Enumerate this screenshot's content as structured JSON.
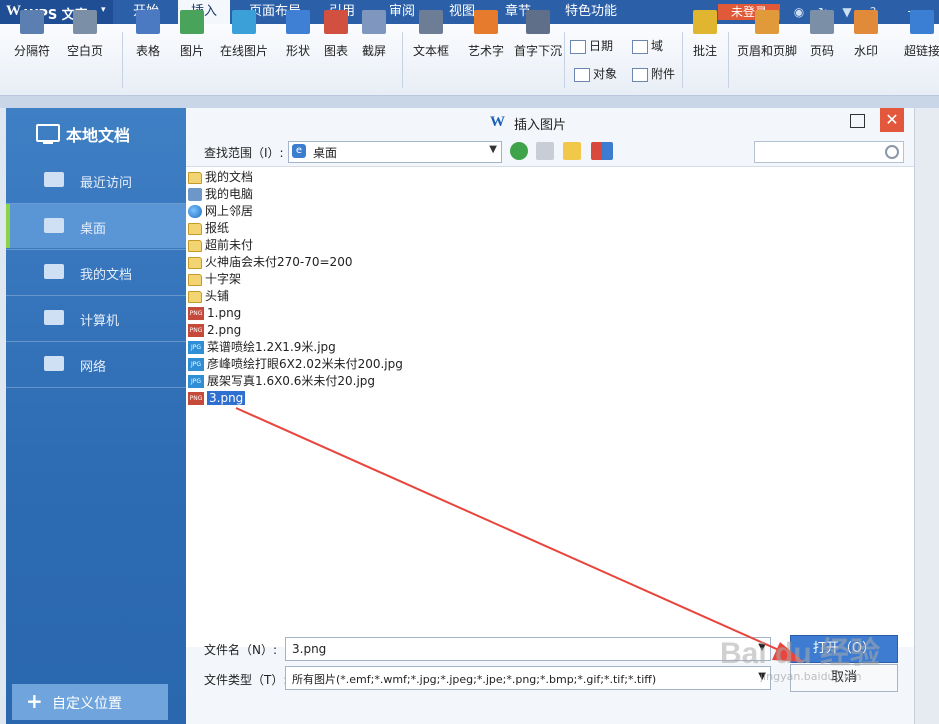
{
  "app": {
    "logo_letter": "W",
    "title": "WPS 文字",
    "dropdown": "▾",
    "login": "未登录"
  },
  "menu_tabs": [
    "开始",
    "插入",
    "页面布局",
    "引用",
    "审阅",
    "视图",
    "章节",
    "特色功能"
  ],
  "active_tab": "插入",
  "window_controls": {
    "help": "?",
    "minimize": "—"
  },
  "ribbon": {
    "large": [
      "分隔符",
      "空白页",
      "表格",
      "图片",
      "在线图片",
      "形状",
      "图表",
      "截屏",
      "文本框",
      "艺术字",
      "首字下沉"
    ],
    "small": [
      "日期",
      "域",
      "对象",
      "附件"
    ],
    "large2": [
      "批注",
      "页眉和页脚",
      "页码",
      "水印",
      "超链接"
    ]
  },
  "left_panel": {
    "title": "本地文档",
    "items": [
      "最近访问",
      "桌面",
      "我的文档",
      "计算机",
      "网络"
    ],
    "selected": "桌面",
    "custom_button": "自定义位置"
  },
  "dialog": {
    "title_letter": "W",
    "title": "插入图片",
    "close": "✕",
    "lookin_label": "查找范围（I）:",
    "lookin_value": "桌面",
    "files": [
      {
        "name": "我的文档",
        "type": "folder"
      },
      {
        "name": "我的电脑",
        "type": "sys"
      },
      {
        "name": "网上邻居",
        "type": "net"
      },
      {
        "name": "报纸",
        "type": "folder"
      },
      {
        "name": "超前未付",
        "type": "folder"
      },
      {
        "name": "火神庙会未付270-70=200",
        "type": "folder"
      },
      {
        "name": "十字架",
        "type": "folder"
      },
      {
        "name": "头铺",
        "type": "folder"
      },
      {
        "name": "1.png",
        "type": "png"
      },
      {
        "name": "2.png",
        "type": "png"
      },
      {
        "name": "菜谱喷绘1.2X1.9米.jpg",
        "type": "jpg"
      },
      {
        "name": "彦峰喷绘打眼6X2.02米未付200.jpg",
        "type": "jpg"
      },
      {
        "name": "展架写真1.6X0.6米未付20.jpg",
        "type": "jpg"
      },
      {
        "name": "3.png",
        "type": "png"
      }
    ],
    "selected_file": "3.png",
    "filename_label": "文件名（N）:",
    "filename_value": "3.png",
    "filetype_label": "文件类型（T）:",
    "filetype_value": "所有图片(*.emf;*.wmf;*.jpg;*.jpeg;*.jpe;*.png;*.bmp;*.gif;*.tif;*.tiff)",
    "open_button": "打开（O）",
    "cancel_button": "取消"
  },
  "icon_tags": {
    "png": "PNG",
    "jpg": "JPG"
  },
  "watermark": {
    "text": "Bai du 经验",
    "sub": "jingyan.baidu.com"
  },
  "colors": {
    "menubar": "#2b5fa8",
    "accent": "#e3583d",
    "selection": "#2f6fcf",
    "arrow": "#e8453c"
  }
}
